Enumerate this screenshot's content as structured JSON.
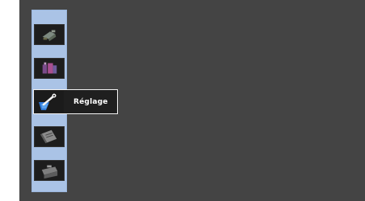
{
  "menu": {
    "items": [
      {
        "icon": "video-camera-icon",
        "label": ""
      },
      {
        "icon": "media-icon",
        "label": ""
      },
      {
        "icon": "settings-wrench-icon",
        "label": "Réglage",
        "selected": true
      },
      {
        "icon": "pencil-note-icon",
        "label": ""
      },
      {
        "icon": "toolbox-icon",
        "label": ""
      }
    ],
    "selected_label": "Réglage"
  },
  "colors": {
    "screen_bg": "#444444",
    "rail_bg": "#aac3e6",
    "item_bg": "#222222",
    "highlight_border": "#f2f2f2",
    "label_text": "#ffffff"
  }
}
